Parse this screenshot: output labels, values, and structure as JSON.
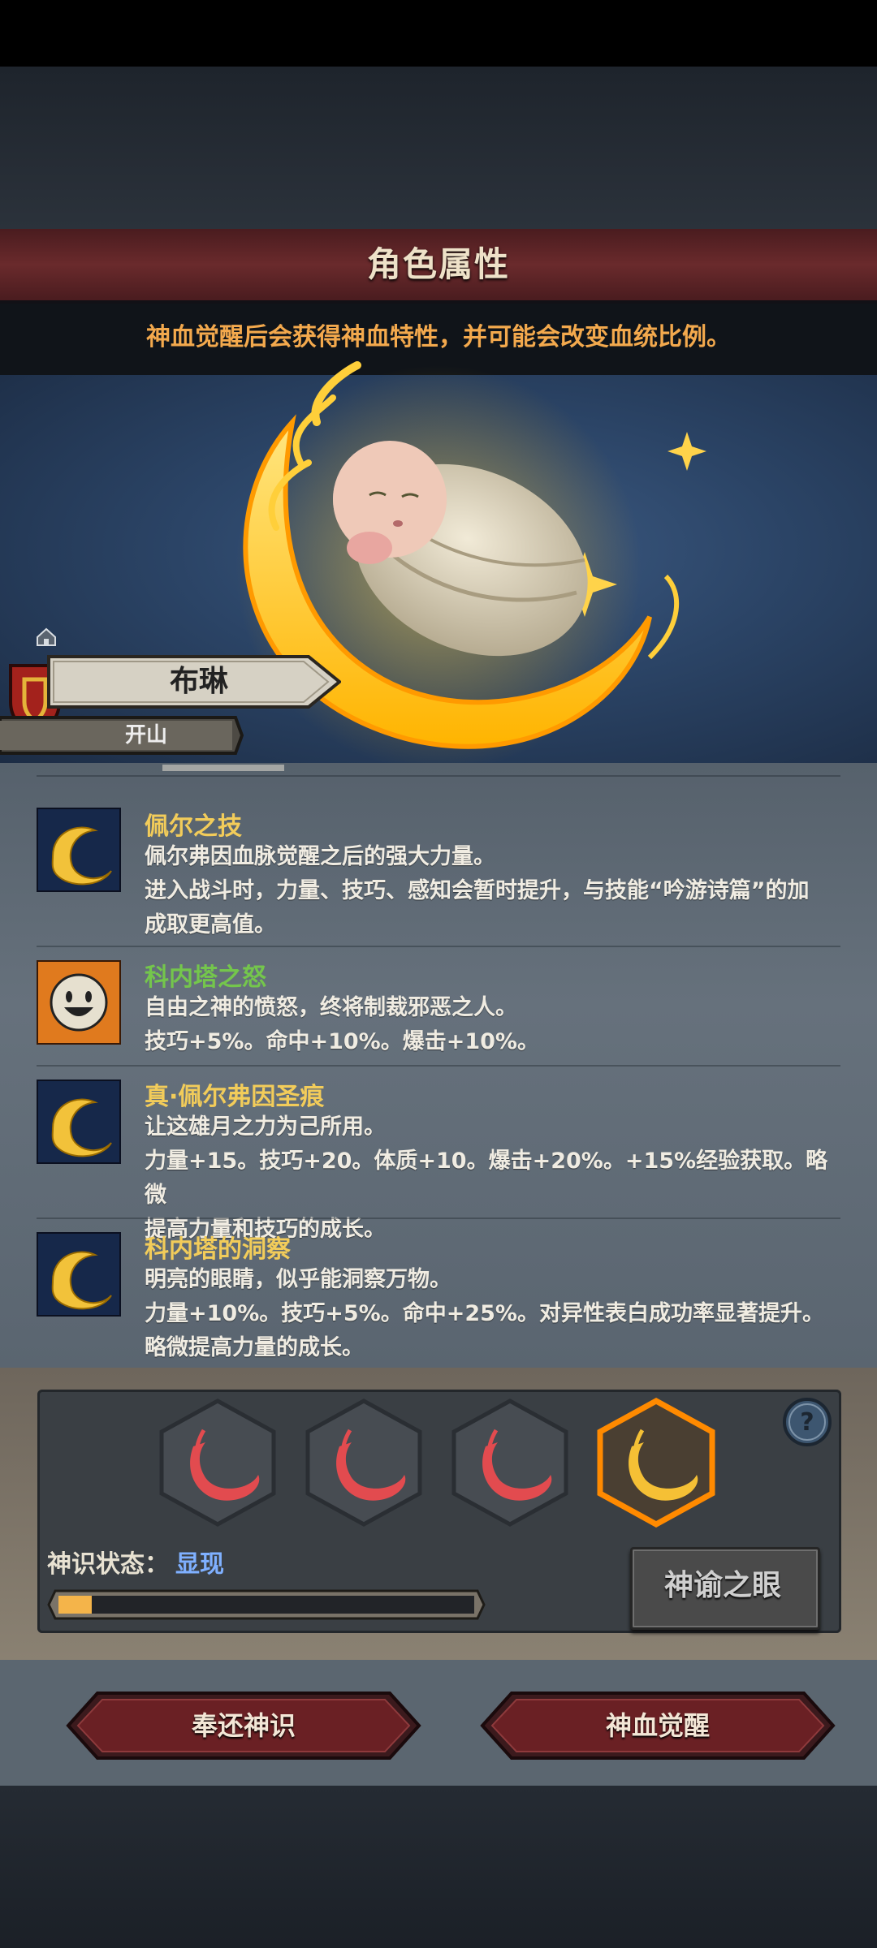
{
  "header": {
    "title": "角色属性",
    "notice": "神血觉醒后会获得神血特性，并可能会改变血统比例。"
  },
  "character": {
    "name": "布琳",
    "rank": "开山"
  },
  "traits": [
    {
      "title": "佩尔之技",
      "color": "gold",
      "icon": "crescent-moon-icon",
      "lines": [
        "佩尔弗因血脉觉醒之后的强大力量。",
        "进入战斗时，力量、技巧、感知会暂时提升，与技能“吟游诗篇”的加",
        "成取更高值。"
      ]
    },
    {
      "title": "科内塔之怒",
      "color": "green",
      "icon": "smiling-sun-icon",
      "lines": [
        "自由之神的愤怒，终将制裁邪恶之人。",
        "技巧+5%。命中+10%。爆击+10%。"
      ]
    },
    {
      "title": "真·佩尔弗因圣痕",
      "color": "gold",
      "icon": "crescent-moon-icon",
      "lines": [
        "让这雄月之力为己所用。",
        "力量+15。技巧+20。体质+10。爆击+20%。+15%经验获取。略微",
        "提高力量和技巧的成长。"
      ]
    },
    {
      "title": "科内塔的洞察",
      "color": "gold",
      "icon": "crescent-moon-icon",
      "lines": [
        "明亮的眼睛，似乎能洞察万物。",
        "力量+10%。技巧+5%。命中+25%。对异性表白成功率显著提升。",
        "略微提高力量的成长。"
      ]
    }
  ],
  "divinity": {
    "slots": [
      {
        "state": "red",
        "icon": "red-crescent-icon"
      },
      {
        "state": "red",
        "icon": "red-crescent-icon"
      },
      {
        "state": "red",
        "icon": "red-crescent-icon"
      },
      {
        "state": "gold-active",
        "icon": "gold-crescent-icon"
      }
    ],
    "status_label": "神识状态：",
    "status_value": "显现",
    "progress": 0.08,
    "oracle_button": "神谕之眼"
  },
  "actions": {
    "return_button": "奉还神识",
    "awaken_button": "神血觉醒"
  },
  "colors": {
    "gold_title": "#f2cc5a",
    "green_title": "#74c64c",
    "notice": "#f3a94d",
    "status_value": "#7fb0ff",
    "button_red": "#6a2024"
  }
}
